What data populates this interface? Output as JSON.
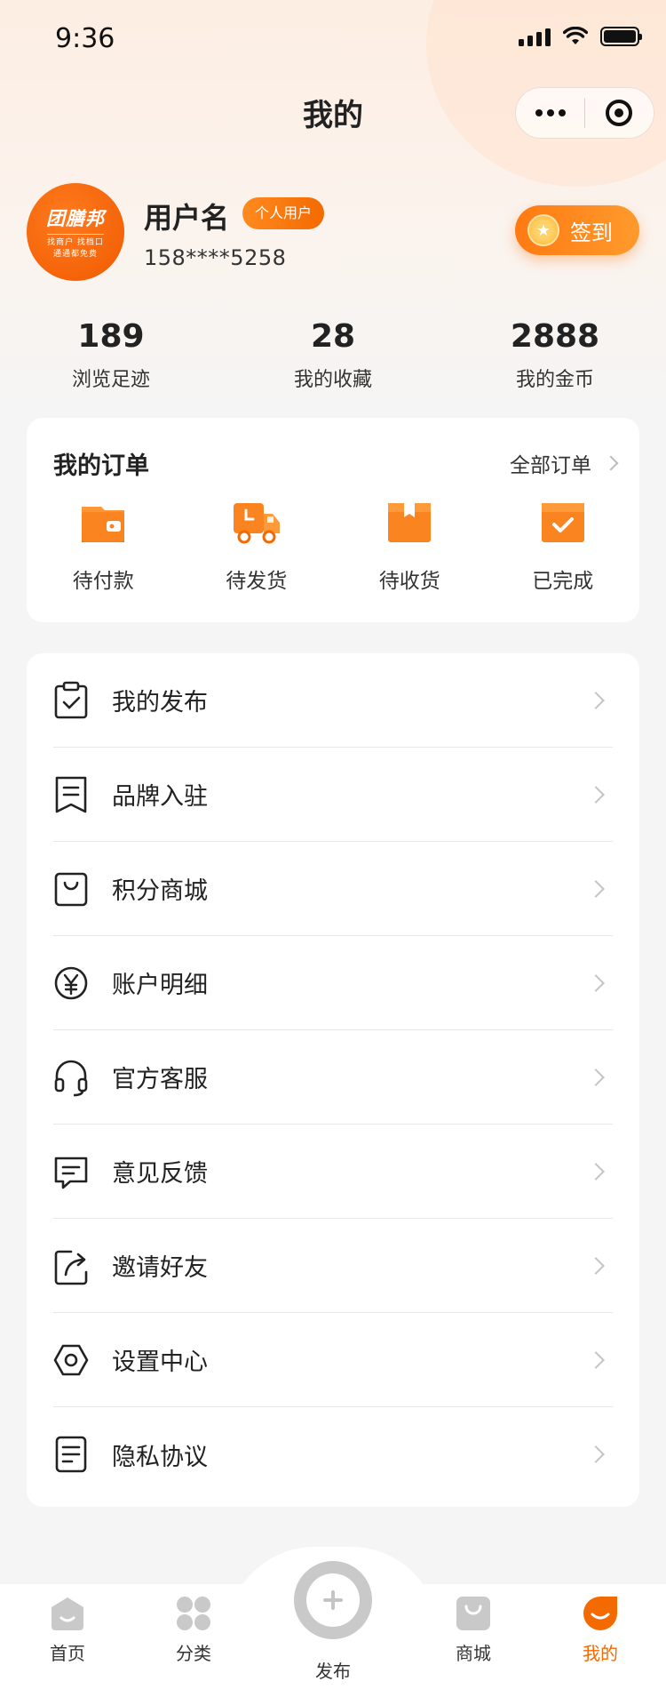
{
  "status_bar": {
    "time": "9:36"
  },
  "nav": {
    "title": "我的"
  },
  "profile": {
    "logo_text": "团膳邦",
    "logo_sub_1": "找商户 找档口",
    "logo_sub_2": "通通都免费",
    "username": "用户名",
    "badge": "个人用户",
    "phone": "158****5258",
    "checkin_label": "签到"
  },
  "stats": [
    {
      "value": "189",
      "label": "浏览足迹"
    },
    {
      "value": "28",
      "label": "我的收藏"
    },
    {
      "value": "2888",
      "label": "我的金币"
    }
  ],
  "orders": {
    "title": "我的订单",
    "all_label": "全部订单",
    "items": [
      {
        "label": "待付款",
        "icon": "wallet-icon"
      },
      {
        "label": "待发货",
        "icon": "truck-icon"
      },
      {
        "label": "待收货",
        "icon": "package-icon"
      },
      {
        "label": "已完成",
        "icon": "completed-icon"
      }
    ]
  },
  "menu": [
    {
      "label": "我的发布",
      "icon": "clipboard-check-icon"
    },
    {
      "label": "品牌入驻",
      "icon": "receipt-icon"
    },
    {
      "label": "积分商城",
      "icon": "shopping-bag-icon"
    },
    {
      "label": "账户明细",
      "icon": "yuan-icon"
    },
    {
      "label": "官方客服",
      "icon": "headset-icon"
    },
    {
      "label": "意见反馈",
      "icon": "message-icon"
    },
    {
      "label": "邀请好友",
      "icon": "share-icon"
    },
    {
      "label": "设置中心",
      "icon": "settings-hexagon-icon"
    },
    {
      "label": "隐私协议",
      "icon": "document-icon"
    }
  ],
  "tabbar": {
    "items": [
      {
        "label": "首页",
        "icon": "home-icon"
      },
      {
        "label": "分类",
        "icon": "category-icon"
      },
      {
        "label": "商城",
        "icon": "shop-bag-icon"
      },
      {
        "label": "我的",
        "icon": "profile-face-icon"
      }
    ],
    "publish_label": "发布",
    "active_color": "#f36a00",
    "inactive_color": "#c9c9c9"
  },
  "colors": {
    "accent": "#f36a00",
    "accent_light": "#ff9a2c"
  }
}
